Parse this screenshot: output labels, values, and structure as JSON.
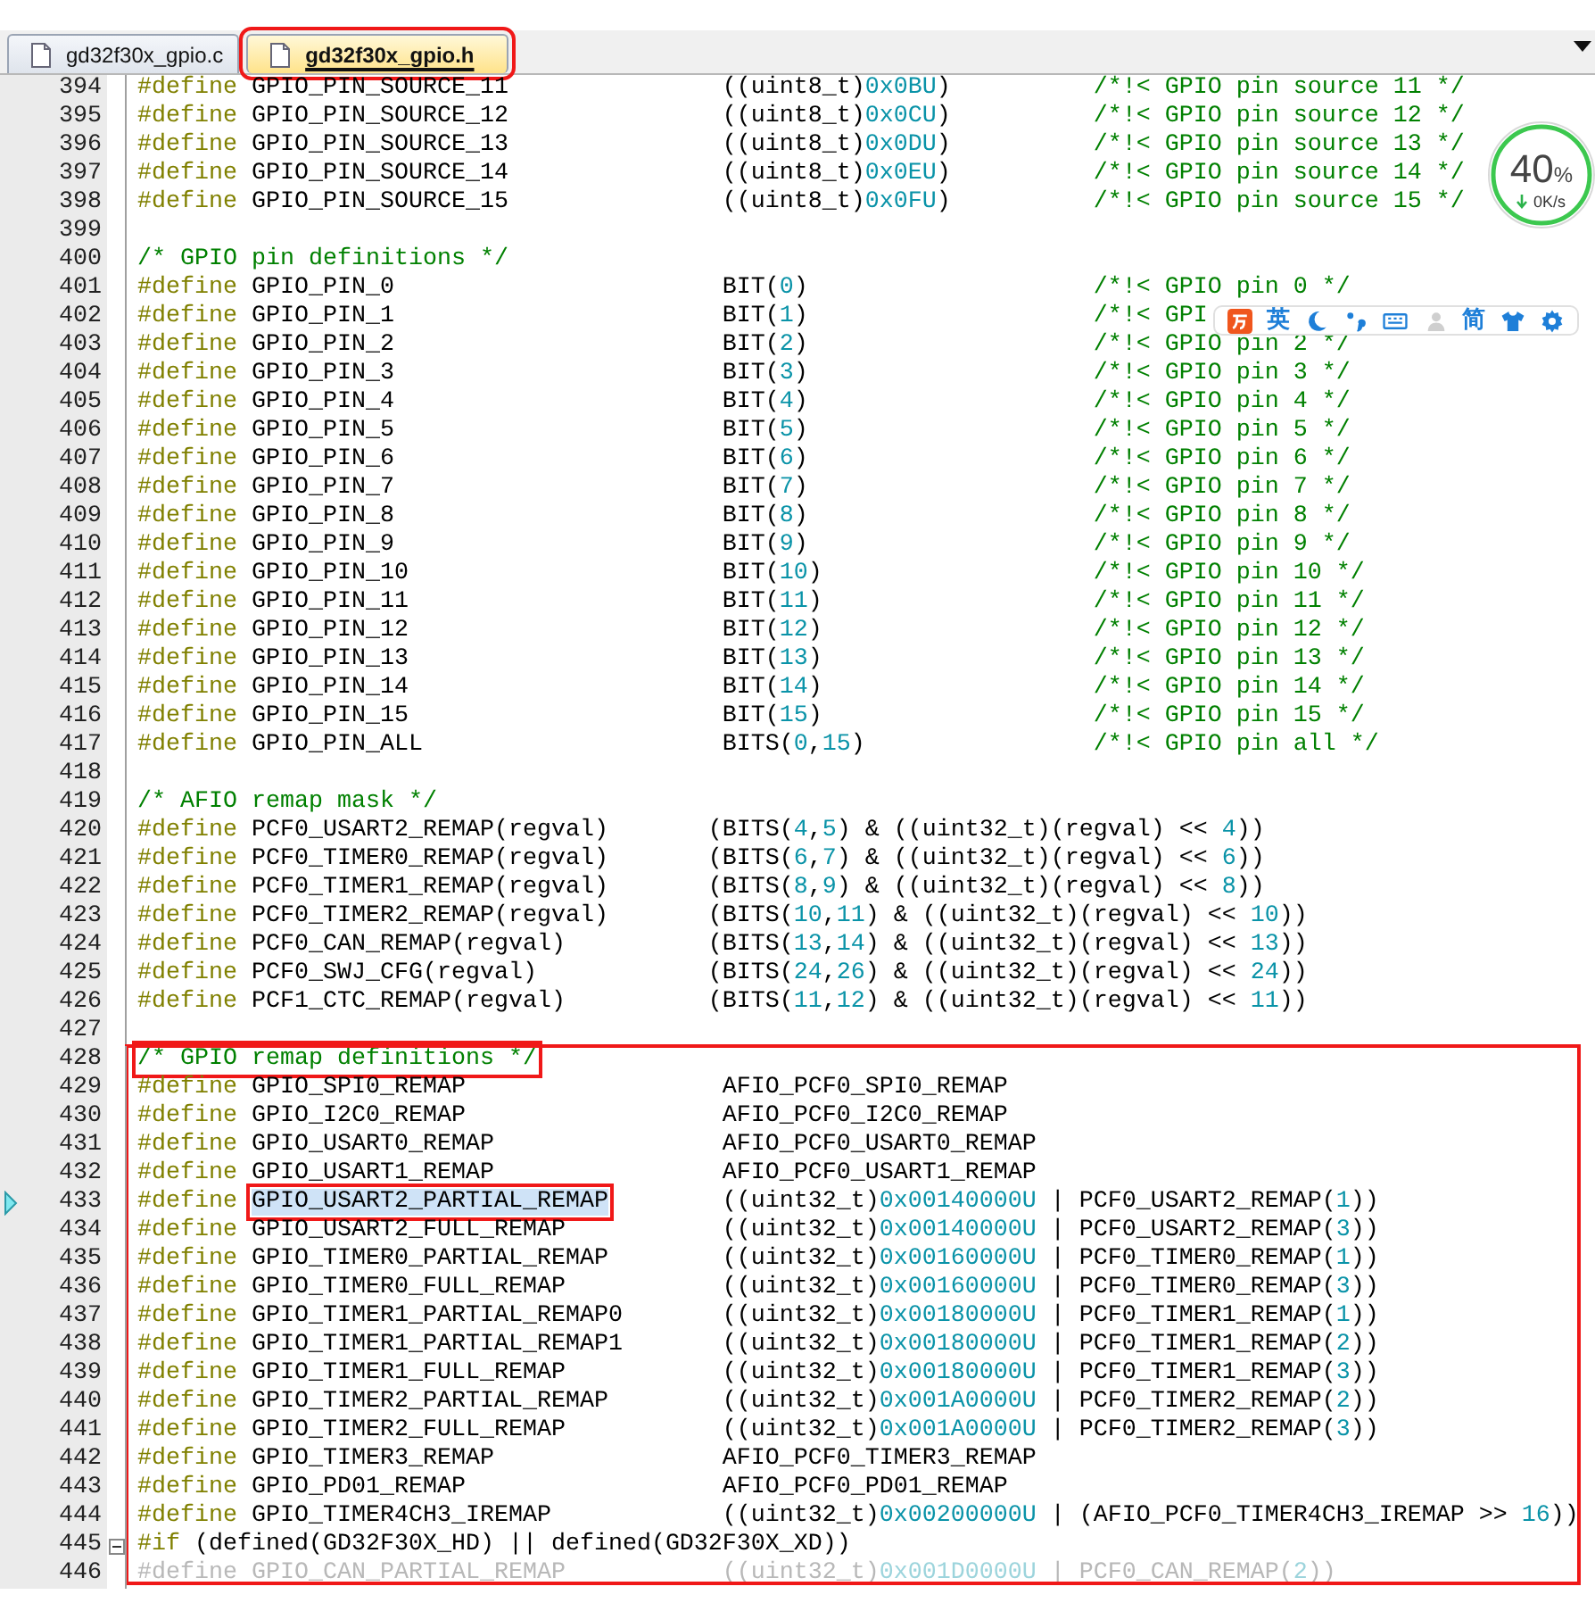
{
  "tabs": [
    {
      "label": "gd32f30x_gpio.c",
      "selected": false,
      "highlighted": false
    },
    {
      "label": "gd32f30x_gpio.h",
      "selected": true,
      "highlighted": true
    }
  ],
  "blocks": [
    {
      "kind": "pins",
      "boxed": false,
      "lines": [
        {
          "n": "394",
          "cells": [
            [
              {
                "kind": "d",
                "text": "#define"
              },
              {
                "kind": "i",
                "text": " GPIO_PIN_SOURCE_11"
              }
            ],
            [
              {
                "kind": "i",
                "text": "((uint8_t)"
              },
              {
                "kind": "n",
                "text": "0x0BU"
              },
              {
                "kind": "i",
                "text": ")"
              }
            ],
            [
              {
                "kind": "c",
                "text": "/*!< GPIO pin source 11 */"
              }
            ]
          ]
        },
        {
          "n": "395",
          "cells": [
            [
              {
                "kind": "d",
                "text": "#define"
              },
              {
                "kind": "i",
                "text": " GPIO_PIN_SOURCE_12"
              }
            ],
            [
              {
                "kind": "i",
                "text": "((uint8_t)"
              },
              {
                "kind": "n",
                "text": "0x0CU"
              },
              {
                "kind": "i",
                "text": ")"
              }
            ],
            [
              {
                "kind": "c",
                "text": "/*!< GPIO pin source 12 */"
              }
            ]
          ]
        },
        {
          "n": "396",
          "cells": [
            [
              {
                "kind": "d",
                "text": "#define"
              },
              {
                "kind": "i",
                "text": " GPIO_PIN_SOURCE_13"
              }
            ],
            [
              {
                "kind": "i",
                "text": "((uint8_t)"
              },
              {
                "kind": "n",
                "text": "0x0DU"
              },
              {
                "kind": "i",
                "text": ")"
              }
            ],
            [
              {
                "kind": "c",
                "text": "/*!< GPIO pin source 13 */"
              }
            ]
          ]
        },
        {
          "n": "397",
          "cells": [
            [
              {
                "kind": "d",
                "text": "#define"
              },
              {
                "kind": "i",
                "text": " GPIO_PIN_SOURCE_14"
              }
            ],
            [
              {
                "kind": "i",
                "text": "((uint8_t)"
              },
              {
                "kind": "n",
                "text": "0x0EU"
              },
              {
                "kind": "i",
                "text": ")"
              }
            ],
            [
              {
                "kind": "c",
                "text": "/*!< GPIO pin source 14 */"
              }
            ]
          ]
        },
        {
          "n": "398",
          "cells": [
            [
              {
                "kind": "d",
                "text": "#define"
              },
              {
                "kind": "i",
                "text": " GPIO_PIN_SOURCE_15"
              }
            ],
            [
              {
                "kind": "i",
                "text": "((uint8_t)"
              },
              {
                "kind": "n",
                "text": "0x0FU"
              },
              {
                "kind": "i",
                "text": ")"
              }
            ],
            [
              {
                "kind": "c",
                "text": "/*!< GPIO pin source 15 */"
              }
            ]
          ]
        },
        {
          "n": "399"
        },
        {
          "n": "400",
          "cells": [
            [
              {
                "kind": "c",
                "text": "/* GPIO pin definitions */"
              }
            ]
          ]
        },
        {
          "n": "401",
          "cells": [
            [
              {
                "kind": "d",
                "text": "#define"
              },
              {
                "kind": "i",
                "text": " GPIO_PIN_0"
              }
            ],
            [
              {
                "kind": "i",
                "text": "BIT("
              },
              {
                "kind": "n",
                "text": "0"
              },
              {
                "kind": "i",
                "text": ")"
              }
            ],
            [
              {
                "kind": "c",
                "text": "/*!< GPIO pin 0 */"
              }
            ]
          ]
        },
        {
          "n": "402",
          "cells": [
            [
              {
                "kind": "d",
                "text": "#define"
              },
              {
                "kind": "i",
                "text": " GPIO_PIN_1"
              }
            ],
            [
              {
                "kind": "i",
                "text": "BIT("
              },
              {
                "kind": "n",
                "text": "1"
              },
              {
                "kind": "i",
                "text": ")"
              }
            ],
            [
              {
                "kind": "c",
                "text": "/*!< GPI"
              }
            ]
          ]
        },
        {
          "n": "403",
          "cells": [
            [
              {
                "kind": "d",
                "text": "#define"
              },
              {
                "kind": "i",
                "text": " GPIO_PIN_2"
              }
            ],
            [
              {
                "kind": "i",
                "text": "BIT("
              },
              {
                "kind": "n",
                "text": "2"
              },
              {
                "kind": "i",
                "text": ")"
              }
            ],
            [
              {
                "kind": "c",
                "text": "/*!< GPIO pin 2 */"
              }
            ]
          ]
        },
        {
          "n": "404",
          "cells": [
            [
              {
                "kind": "d",
                "text": "#define"
              },
              {
                "kind": "i",
                "text": " GPIO_PIN_3"
              }
            ],
            [
              {
                "kind": "i",
                "text": "BIT("
              },
              {
                "kind": "n",
                "text": "3"
              },
              {
                "kind": "i",
                "text": ")"
              }
            ],
            [
              {
                "kind": "c",
                "text": "/*!< GPIO pin 3 */"
              }
            ]
          ]
        },
        {
          "n": "405",
          "cells": [
            [
              {
                "kind": "d",
                "text": "#define"
              },
              {
                "kind": "i",
                "text": " GPIO_PIN_4"
              }
            ],
            [
              {
                "kind": "i",
                "text": "BIT("
              },
              {
                "kind": "n",
                "text": "4"
              },
              {
                "kind": "i",
                "text": ")"
              }
            ],
            [
              {
                "kind": "c",
                "text": "/*!< GPIO pin 4 */"
              }
            ]
          ]
        },
        {
          "n": "406",
          "cells": [
            [
              {
                "kind": "d",
                "text": "#define"
              },
              {
                "kind": "i",
                "text": " GPIO_PIN_5"
              }
            ],
            [
              {
                "kind": "i",
                "text": "BIT("
              },
              {
                "kind": "n",
                "text": "5"
              },
              {
                "kind": "i",
                "text": ")"
              }
            ],
            [
              {
                "kind": "c",
                "text": "/*!< GPIO pin 5 */"
              }
            ]
          ]
        },
        {
          "n": "407",
          "cells": [
            [
              {
                "kind": "d",
                "text": "#define"
              },
              {
                "kind": "i",
                "text": " GPIO_PIN_6"
              }
            ],
            [
              {
                "kind": "i",
                "text": "BIT("
              },
              {
                "kind": "n",
                "text": "6"
              },
              {
                "kind": "i",
                "text": ")"
              }
            ],
            [
              {
                "kind": "c",
                "text": "/*!< GPIO pin 6 */"
              }
            ]
          ]
        },
        {
          "n": "408",
          "cells": [
            [
              {
                "kind": "d",
                "text": "#define"
              },
              {
                "kind": "i",
                "text": " GPIO_PIN_7"
              }
            ],
            [
              {
                "kind": "i",
                "text": "BIT("
              },
              {
                "kind": "n",
                "text": "7"
              },
              {
                "kind": "i",
                "text": ")"
              }
            ],
            [
              {
                "kind": "c",
                "text": "/*!< GPIO pin 7 */"
              }
            ]
          ]
        },
        {
          "n": "409",
          "cells": [
            [
              {
                "kind": "d",
                "text": "#define"
              },
              {
                "kind": "i",
                "text": " GPIO_PIN_8"
              }
            ],
            [
              {
                "kind": "i",
                "text": "BIT("
              },
              {
                "kind": "n",
                "text": "8"
              },
              {
                "kind": "i",
                "text": ")"
              }
            ],
            [
              {
                "kind": "c",
                "text": "/*!< GPIO pin 8 */"
              }
            ]
          ]
        },
        {
          "n": "410",
          "cells": [
            [
              {
                "kind": "d",
                "text": "#define"
              },
              {
                "kind": "i",
                "text": " GPIO_PIN_9"
              }
            ],
            [
              {
                "kind": "i",
                "text": "BIT("
              },
              {
                "kind": "n",
                "text": "9"
              },
              {
                "kind": "i",
                "text": ")"
              }
            ],
            [
              {
                "kind": "c",
                "text": "/*!< GPIO pin 9 */"
              }
            ]
          ]
        },
        {
          "n": "411",
          "cells": [
            [
              {
                "kind": "d",
                "text": "#define"
              },
              {
                "kind": "i",
                "text": " GPIO_PIN_10"
              }
            ],
            [
              {
                "kind": "i",
                "text": "BIT("
              },
              {
                "kind": "n",
                "text": "10"
              },
              {
                "kind": "i",
                "text": ")"
              }
            ],
            [
              {
                "kind": "c",
                "text": "/*!< GPIO pin 10 */"
              }
            ]
          ]
        },
        {
          "n": "412",
          "cells": [
            [
              {
                "kind": "d",
                "text": "#define"
              },
              {
                "kind": "i",
                "text": " GPIO_PIN_11"
              }
            ],
            [
              {
                "kind": "i",
                "text": "BIT("
              },
              {
                "kind": "n",
                "text": "11"
              },
              {
                "kind": "i",
                "text": ")"
              }
            ],
            [
              {
                "kind": "c",
                "text": "/*!< GPIO pin 11 */"
              }
            ]
          ]
        },
        {
          "n": "413",
          "cells": [
            [
              {
                "kind": "d",
                "text": "#define"
              },
              {
                "kind": "i",
                "text": " GPIO_PIN_12"
              }
            ],
            [
              {
                "kind": "i",
                "text": "BIT("
              },
              {
                "kind": "n",
                "text": "12"
              },
              {
                "kind": "i",
                "text": ")"
              }
            ],
            [
              {
                "kind": "c",
                "text": "/*!< GPIO pin 12 */"
              }
            ]
          ]
        },
        {
          "n": "414",
          "cells": [
            [
              {
                "kind": "d",
                "text": "#define"
              },
              {
                "kind": "i",
                "text": " GPIO_PIN_13"
              }
            ],
            [
              {
                "kind": "i",
                "text": "BIT("
              },
              {
                "kind": "n",
                "text": "13"
              },
              {
                "kind": "i",
                "text": ")"
              }
            ],
            [
              {
                "kind": "c",
                "text": "/*!< GPIO pin 13 */"
              }
            ]
          ]
        },
        {
          "n": "415",
          "cells": [
            [
              {
                "kind": "d",
                "text": "#define"
              },
              {
                "kind": "i",
                "text": " GPIO_PIN_14"
              }
            ],
            [
              {
                "kind": "i",
                "text": "BIT("
              },
              {
                "kind": "n",
                "text": "14"
              },
              {
                "kind": "i",
                "text": ")"
              }
            ],
            [
              {
                "kind": "c",
                "text": "/*!< GPIO pin 14 */"
              }
            ]
          ]
        },
        {
          "n": "416",
          "cells": [
            [
              {
                "kind": "d",
                "text": "#define"
              },
              {
                "kind": "i",
                "text": " GPIO_PIN_15"
              }
            ],
            [
              {
                "kind": "i",
                "text": "BIT("
              },
              {
                "kind": "n",
                "text": "15"
              },
              {
                "kind": "i",
                "text": ")"
              }
            ],
            [
              {
                "kind": "c",
                "text": "/*!< GPIO pin 15 */"
              }
            ]
          ]
        },
        {
          "n": "417",
          "cells": [
            [
              {
                "kind": "d",
                "text": "#define"
              },
              {
                "kind": "i",
                "text": " GPIO_PIN_ALL"
              }
            ],
            [
              {
                "kind": "i",
                "text": "BITS("
              },
              {
                "kind": "n",
                "text": "0"
              },
              {
                "kind": "i",
                "text": ","
              },
              {
                "kind": "n",
                "text": "15"
              },
              {
                "kind": "i",
                "text": ")"
              }
            ],
            [
              {
                "kind": "c",
                "text": "/*!< GPIO pin all */"
              }
            ]
          ]
        },
        {
          "n": "418"
        }
      ]
    },
    {
      "kind": "mask",
      "boxed": false,
      "lines": [
        {
          "n": "419",
          "cells": [
            [
              {
                "kind": "c",
                "text": "/* AFIO remap mask */"
              }
            ]
          ]
        },
        {
          "n": "420",
          "cells": [
            [
              {
                "kind": "d",
                "text": "#define"
              },
              {
                "kind": "i",
                "text": " PCF0_USART2_REMAP(regval)"
              }
            ],
            [
              {
                "kind": "i",
                "text": "(BITS("
              },
              {
                "kind": "n",
                "text": "4"
              },
              {
                "kind": "i",
                "text": ","
              },
              {
                "kind": "n",
                "text": "5"
              },
              {
                "kind": "i",
                "text": ") & ((uint32_t)(regval) << "
              },
              {
                "kind": "n",
                "text": "4"
              },
              {
                "kind": "i",
                "text": "))"
              }
            ]
          ]
        },
        {
          "n": "421",
          "cells": [
            [
              {
                "kind": "d",
                "text": "#define"
              },
              {
                "kind": "i",
                "text": " PCF0_TIMER0_REMAP(regval)"
              }
            ],
            [
              {
                "kind": "i",
                "text": "(BITS("
              },
              {
                "kind": "n",
                "text": "6"
              },
              {
                "kind": "i",
                "text": ","
              },
              {
                "kind": "n",
                "text": "7"
              },
              {
                "kind": "i",
                "text": ") & ((uint32_t)(regval) << "
              },
              {
                "kind": "n",
                "text": "6"
              },
              {
                "kind": "i",
                "text": "))"
              }
            ]
          ]
        },
        {
          "n": "422",
          "cells": [
            [
              {
                "kind": "d",
                "text": "#define"
              },
              {
                "kind": "i",
                "text": " PCF0_TIMER1_REMAP(regval)"
              }
            ],
            [
              {
                "kind": "i",
                "text": "(BITS("
              },
              {
                "kind": "n",
                "text": "8"
              },
              {
                "kind": "i",
                "text": ","
              },
              {
                "kind": "n",
                "text": "9"
              },
              {
                "kind": "i",
                "text": ") & ((uint32_t)(regval) << "
              },
              {
                "kind": "n",
                "text": "8"
              },
              {
                "kind": "i",
                "text": "))"
              }
            ]
          ]
        },
        {
          "n": "423",
          "cells": [
            [
              {
                "kind": "d",
                "text": "#define"
              },
              {
                "kind": "i",
                "text": " PCF0_TIMER2_REMAP(regval)"
              }
            ],
            [
              {
                "kind": "i",
                "text": "(BITS("
              },
              {
                "kind": "n",
                "text": "10"
              },
              {
                "kind": "i",
                "text": ","
              },
              {
                "kind": "n",
                "text": "11"
              },
              {
                "kind": "i",
                "text": ") & ((uint32_t)(regval) << "
              },
              {
                "kind": "n",
                "text": "10"
              },
              {
                "kind": "i",
                "text": "))"
              }
            ]
          ]
        },
        {
          "n": "424",
          "cells": [
            [
              {
                "kind": "d",
                "text": "#define"
              },
              {
                "kind": "i",
                "text": " PCF0_CAN_REMAP(regval)"
              }
            ],
            [
              {
                "kind": "i",
                "text": "(BITS("
              },
              {
                "kind": "n",
                "text": "13"
              },
              {
                "kind": "i",
                "text": ","
              },
              {
                "kind": "n",
                "text": "14"
              },
              {
                "kind": "i",
                "text": ") & ((uint32_t)(regval) << "
              },
              {
                "kind": "n",
                "text": "13"
              },
              {
                "kind": "i",
                "text": "))"
              }
            ]
          ]
        },
        {
          "n": "425",
          "cells": [
            [
              {
                "kind": "d",
                "text": "#define"
              },
              {
                "kind": "i",
                "text": " PCF0_SWJ_CFG(regval)"
              }
            ],
            [
              {
                "kind": "i",
                "text": "(BITS("
              },
              {
                "kind": "n",
                "text": "24"
              },
              {
                "kind": "i",
                "text": ","
              },
              {
                "kind": "n",
                "text": "26"
              },
              {
                "kind": "i",
                "text": ") & ((uint32_t)(regval) << "
              },
              {
                "kind": "n",
                "text": "24"
              },
              {
                "kind": "i",
                "text": "))"
              }
            ]
          ]
        },
        {
          "n": "426",
          "cells": [
            [
              {
                "kind": "d",
                "text": "#define"
              },
              {
                "kind": "i",
                "text": " PCF1_CTC_REMAP(regval)"
              }
            ],
            [
              {
                "kind": "i",
                "text": "(BITS("
              },
              {
                "kind": "n",
                "text": "11"
              },
              {
                "kind": "i",
                "text": ","
              },
              {
                "kind": "n",
                "text": "12"
              },
              {
                "kind": "i",
                "text": ") & ((uint32_t)(regval) << "
              },
              {
                "kind": "n",
                "text": "11"
              },
              {
                "kind": "i",
                "text": "))"
              }
            ]
          ]
        },
        {
          "n": "427"
        }
      ]
    },
    {
      "kind": "remap",
      "boxed": true,
      "lines": [
        {
          "n": "428",
          "cells": [
            [
              {
                "kind": "c",
                "text": "/* GPIO remap definitions */",
                "boxed": true
              }
            ]
          ]
        },
        {
          "n": "429",
          "cells": [
            [
              {
                "kind": "d",
                "text": "#define"
              },
              {
                "kind": "i",
                "text": " GPIO_SPI0_REMAP"
              }
            ],
            [
              {
                "kind": "i",
                "text": "AFIO_PCF0_SPI0_REMAP"
              }
            ]
          ]
        },
        {
          "n": "430",
          "cells": [
            [
              {
                "kind": "d",
                "text": "#define"
              },
              {
                "kind": "i",
                "text": " GPIO_I2C0_REMAP"
              }
            ],
            [
              {
                "kind": "i",
                "text": "AFIO_PCF0_I2C0_REMAP"
              }
            ]
          ]
        },
        {
          "n": "431",
          "cells": [
            [
              {
                "kind": "d",
                "text": "#define"
              },
              {
                "kind": "i",
                "text": " GPIO_USART0_REMAP"
              }
            ],
            [
              {
                "kind": "i",
                "text": "AFIO_PCF0_USART0_REMAP"
              }
            ]
          ]
        },
        {
          "n": "432",
          "cells": [
            [
              {
                "kind": "d",
                "text": "#define"
              },
              {
                "kind": "i",
                "text": " GPIO_USART1_REMAP"
              }
            ],
            [
              {
                "kind": "i",
                "text": "AFIO_PCF0_USART1_REMAP"
              }
            ]
          ]
        },
        {
          "n": "433",
          "marker": true,
          "cells": [
            [
              {
                "kind": "d",
                "text": "#define"
              },
              {
                "kind": "i",
                "text": "GPIO_USART2_PARTIAL_REMAP",
                "boxed": true
              }
            ],
            [
              {
                "kind": "i",
                "text": "((uint32_t)"
              },
              {
                "kind": "n",
                "text": "0x00140000U"
              },
              {
                "kind": "i",
                "text": " | PCF0_USART2_REMAP("
              },
              {
                "kind": "n",
                "text": "1"
              },
              {
                "kind": "i",
                "text": "))"
              }
            ]
          ]
        },
        {
          "n": "434",
          "cells": [
            [
              {
                "kind": "d",
                "text": "#define"
              },
              {
                "kind": "i",
                "text": " GPIO_USART2_FULL_REMAP"
              }
            ],
            [
              {
                "kind": "i",
                "text": "((uint32_t)"
              },
              {
                "kind": "n",
                "text": "0x00140000U"
              },
              {
                "kind": "i",
                "text": " | PCF0_USART2_REMAP("
              },
              {
                "kind": "n",
                "text": "3"
              },
              {
                "kind": "i",
                "text": "))"
              }
            ]
          ]
        },
        {
          "n": "435",
          "cells": [
            [
              {
                "kind": "d",
                "text": "#define"
              },
              {
                "kind": "i",
                "text": " GPIO_TIMER0_PARTIAL_REMAP"
              }
            ],
            [
              {
                "kind": "i",
                "text": "((uint32_t)"
              },
              {
                "kind": "n",
                "text": "0x00160000U"
              },
              {
                "kind": "i",
                "text": " | PCF0_TIMER0_REMAP("
              },
              {
                "kind": "n",
                "text": "1"
              },
              {
                "kind": "i",
                "text": "))"
              }
            ]
          ]
        },
        {
          "n": "436",
          "cells": [
            [
              {
                "kind": "d",
                "text": "#define"
              },
              {
                "kind": "i",
                "text": " GPIO_TIMER0_FULL_REMAP"
              }
            ],
            [
              {
                "kind": "i",
                "text": "((uint32_t)"
              },
              {
                "kind": "n",
                "text": "0x00160000U"
              },
              {
                "kind": "i",
                "text": " | PCF0_TIMER0_REMAP("
              },
              {
                "kind": "n",
                "text": "3"
              },
              {
                "kind": "i",
                "text": "))"
              }
            ]
          ]
        },
        {
          "n": "437",
          "cells": [
            [
              {
                "kind": "d",
                "text": "#define"
              },
              {
                "kind": "i",
                "text": " GPIO_TIMER1_PARTIAL_REMAP0"
              }
            ],
            [
              {
                "kind": "i",
                "text": "((uint32_t)"
              },
              {
                "kind": "n",
                "text": "0x00180000U"
              },
              {
                "kind": "i",
                "text": " | PCF0_TIMER1_REMAP("
              },
              {
                "kind": "n",
                "text": "1"
              },
              {
                "kind": "i",
                "text": "))"
              }
            ]
          ]
        },
        {
          "n": "438",
          "cells": [
            [
              {
                "kind": "d",
                "text": "#define"
              },
              {
                "kind": "i",
                "text": " GPIO_TIMER1_PARTIAL_REMAP1"
              }
            ],
            [
              {
                "kind": "i",
                "text": "((uint32_t)"
              },
              {
                "kind": "n",
                "text": "0x00180000U"
              },
              {
                "kind": "i",
                "text": " | PCF0_TIMER1_REMAP("
              },
              {
                "kind": "n",
                "text": "2"
              },
              {
                "kind": "i",
                "text": "))"
              }
            ]
          ]
        },
        {
          "n": "439",
          "cells": [
            [
              {
                "kind": "d",
                "text": "#define"
              },
              {
                "kind": "i",
                "text": " GPIO_TIMER1_FULL_REMAP"
              }
            ],
            [
              {
                "kind": "i",
                "text": "((uint32_t)"
              },
              {
                "kind": "n",
                "text": "0x00180000U"
              },
              {
                "kind": "i",
                "text": " | PCF0_TIMER1_REMAP("
              },
              {
                "kind": "n",
                "text": "3"
              },
              {
                "kind": "i",
                "text": "))"
              }
            ]
          ]
        },
        {
          "n": "440",
          "cells": [
            [
              {
                "kind": "d",
                "text": "#define"
              },
              {
                "kind": "i",
                "text": " GPIO_TIMER2_PARTIAL_REMAP"
              }
            ],
            [
              {
                "kind": "i",
                "text": "((uint32_t)"
              },
              {
                "kind": "n",
                "text": "0x001A0000U"
              },
              {
                "kind": "i",
                "text": " | PCF0_TIMER2_REMAP("
              },
              {
                "kind": "n",
                "text": "2"
              },
              {
                "kind": "i",
                "text": "))"
              }
            ]
          ]
        },
        {
          "n": "441",
          "cells": [
            [
              {
                "kind": "d",
                "text": "#define"
              },
              {
                "kind": "i",
                "text": " GPIO_TIMER2_FULL_REMAP"
              }
            ],
            [
              {
                "kind": "i",
                "text": "((uint32_t)"
              },
              {
                "kind": "n",
                "text": "0x001A0000U"
              },
              {
                "kind": "i",
                "text": " | PCF0_TIMER2_REMAP("
              },
              {
                "kind": "n",
                "text": "3"
              },
              {
                "kind": "i",
                "text": "))"
              }
            ]
          ]
        },
        {
          "n": "442",
          "cells": [
            [
              {
                "kind": "d",
                "text": "#define"
              },
              {
                "kind": "i",
                "text": " GPIO_TIMER3_REMAP"
              }
            ],
            [
              {
                "kind": "i",
                "text": "AFIO_PCF0_TIMER3_REMAP"
              }
            ]
          ]
        },
        {
          "n": "443",
          "cells": [
            [
              {
                "kind": "d",
                "text": "#define"
              },
              {
                "kind": "i",
                "text": " GPIO_PD01_REMAP"
              }
            ],
            [
              {
                "kind": "i",
                "text": "AFIO_PCF0_PD01_REMAP"
              }
            ]
          ]
        },
        {
          "n": "444",
          "cells": [
            [
              {
                "kind": "d",
                "text": "#define"
              },
              {
                "kind": "i",
                "text": " GPIO_TIMER4CH3_IREMAP"
              }
            ],
            [
              {
                "kind": "i",
                "text": "((uint32_t)"
              },
              {
                "kind": "n",
                "text": "0x00200000U"
              },
              {
                "kind": "i",
                "text": " | (AFIO_PCF0_TIMER4CH3_IREMAP >> "
              },
              {
                "kind": "n",
                "text": "16"
              },
              {
                "kind": "i",
                "text": "))"
              }
            ]
          ]
        },
        {
          "n": "445",
          "fold": true,
          "cells": [
            [
              {
                "kind": "d",
                "text": "#if"
              },
              {
                "kind": "i",
                "text": " (defined(GD32F30X_HD) || defined(GD32F30X_XD))"
              }
            ]
          ]
        },
        {
          "n": "446",
          "cells": [
            [
              {
                "kind": "x",
                "text": "#define GPIO_CAN_PARTIAL_REMAP"
              }
            ],
            [
              {
                "kind": "x",
                "text": "((uint32_t)"
              },
              {
                "kind": "xn",
                "text": "0x001D0000U"
              },
              {
                "kind": "x",
                "text": " | PCF0_CAN_REMAP("
              },
              {
                "kind": "xn",
                "text": "2"
              },
              {
                "kind": "x",
                "text": "))"
              }
            ]
          ]
        }
      ]
    }
  ],
  "meter": {
    "percent": "40",
    "unit": "%",
    "speed": "0K/s"
  },
  "ime_toolbar": [
    {
      "kind": "logo"
    },
    {
      "kind": "text",
      "text": "英"
    },
    {
      "kind": "moon"
    },
    {
      "kind": "punct"
    },
    {
      "kind": "keyboard"
    },
    {
      "kind": "user"
    },
    {
      "kind": "text",
      "text": "简"
    },
    {
      "kind": "shirt"
    },
    {
      "kind": "gear"
    }
  ]
}
